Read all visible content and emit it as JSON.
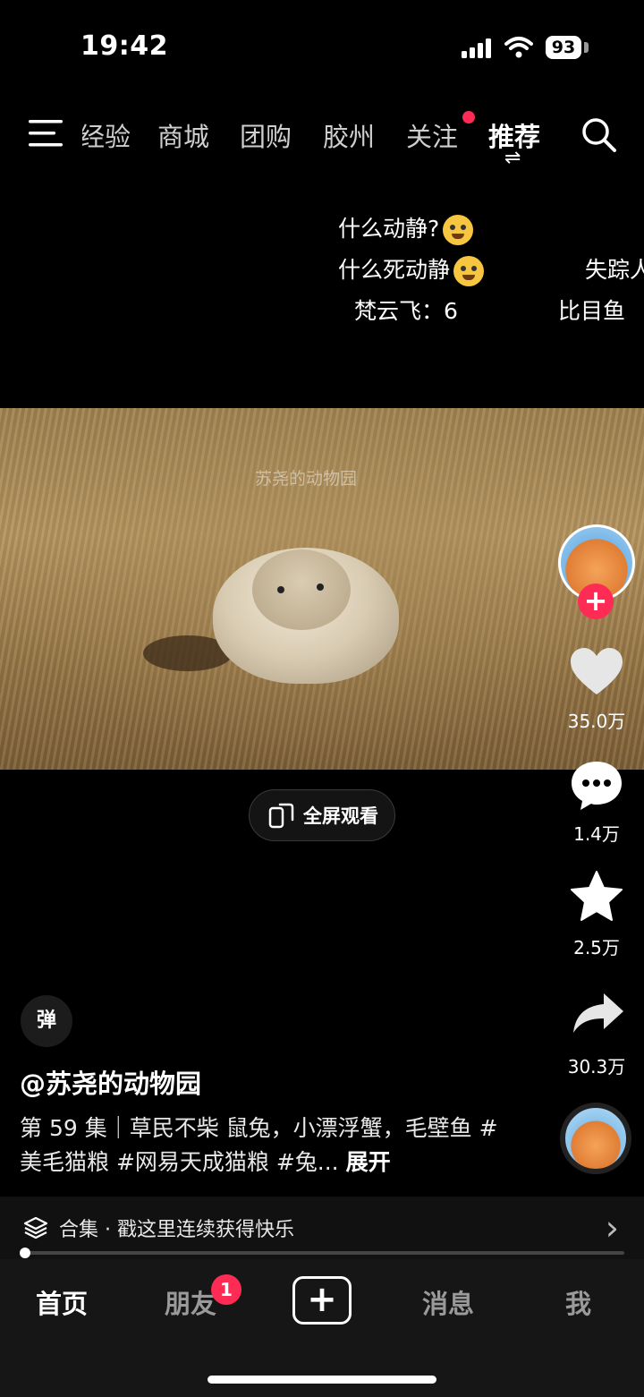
{
  "status_bar": {
    "time": "19:42",
    "battery": "93"
  },
  "top_nav": {
    "tabs": [
      "经验",
      "商城",
      "团购",
      "胶州",
      "关注",
      "推荐"
    ],
    "active": "推荐",
    "switch_arrows": "⇌"
  },
  "danmaku": [
    {
      "text": "什么动静?",
      "emoji": "dizzy-emoji"
    },
    {
      "text": "什么死动静",
      "emoji": "laughing-emoji"
    },
    {
      "text": "梵云飞：6"
    },
    {
      "text": "失踪人"
    },
    {
      "text": "比目鱼"
    }
  ],
  "video": {
    "watermark": "苏尧的动物园"
  },
  "fullscreen_button": {
    "label": "全屏观看"
  },
  "right_rail": {
    "follow_icon": "+",
    "likes": "35.0万",
    "comments": "1.4万",
    "favorites": "2.5万",
    "shares": "30.3万"
  },
  "info": {
    "danmu_toggle": "弹",
    "author": "@苏尧的动物园",
    "description": "第 59 集｜草民不柴 鼠兔，小漂浮蟹，毛壁鱼 #美毛猫粮 #网易天成猫粮 #兔...",
    "expand": "展开"
  },
  "collection": {
    "label": "合集 · 戳这里连续获得快乐",
    "arrow": "›"
  },
  "tab_bar": {
    "home": "首页",
    "friends": "朋友",
    "friends_badge": "1",
    "add": "+",
    "messages": "消息",
    "me": "我"
  },
  "colors": {
    "accent": "#fe2c55",
    "background": "#000000"
  }
}
